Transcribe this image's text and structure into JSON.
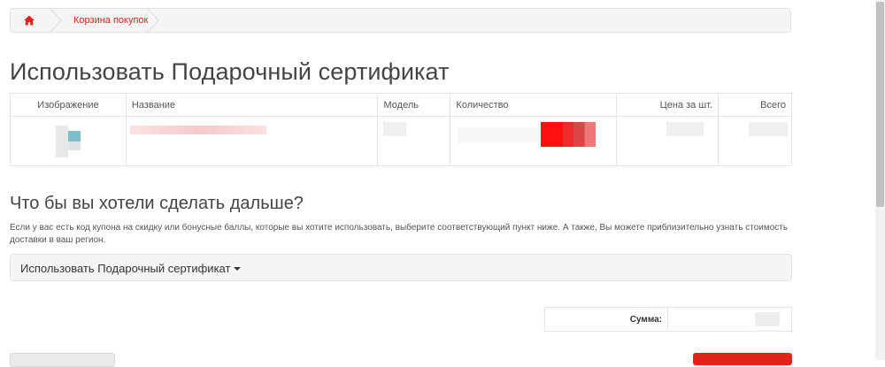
{
  "breadcrumb": {
    "home_icon": "home-icon",
    "items": [
      {
        "label": "Корзина покупок"
      }
    ]
  },
  "page": {
    "title": "Использовать Подарочный сертификат"
  },
  "cart_table": {
    "headers": {
      "image": "Изображение",
      "name": "Название",
      "model": "Модель",
      "quantity": "Количество",
      "unit_price": "Цена за шт.",
      "total": "Всего"
    }
  },
  "next_section": {
    "title": "Что бы вы хотели сделать дальше?",
    "info": "Если у вас есть код купона на скидку или бонусные баллы, которые вы хотите использовать, выберите соответствующий пункт ниже. А также, Вы можете приблизительно узнать стоимость доставки в ваш регион."
  },
  "coupon_panel": {
    "label": "Использовать Подарочный сертификат",
    "icon": "caret-down-icon"
  },
  "totals": {
    "sum_label": "Сумма:"
  },
  "colors": {
    "accent": "#e2231a",
    "panel_bg": "#f5f5f5",
    "border": "#e2e2e2"
  }
}
